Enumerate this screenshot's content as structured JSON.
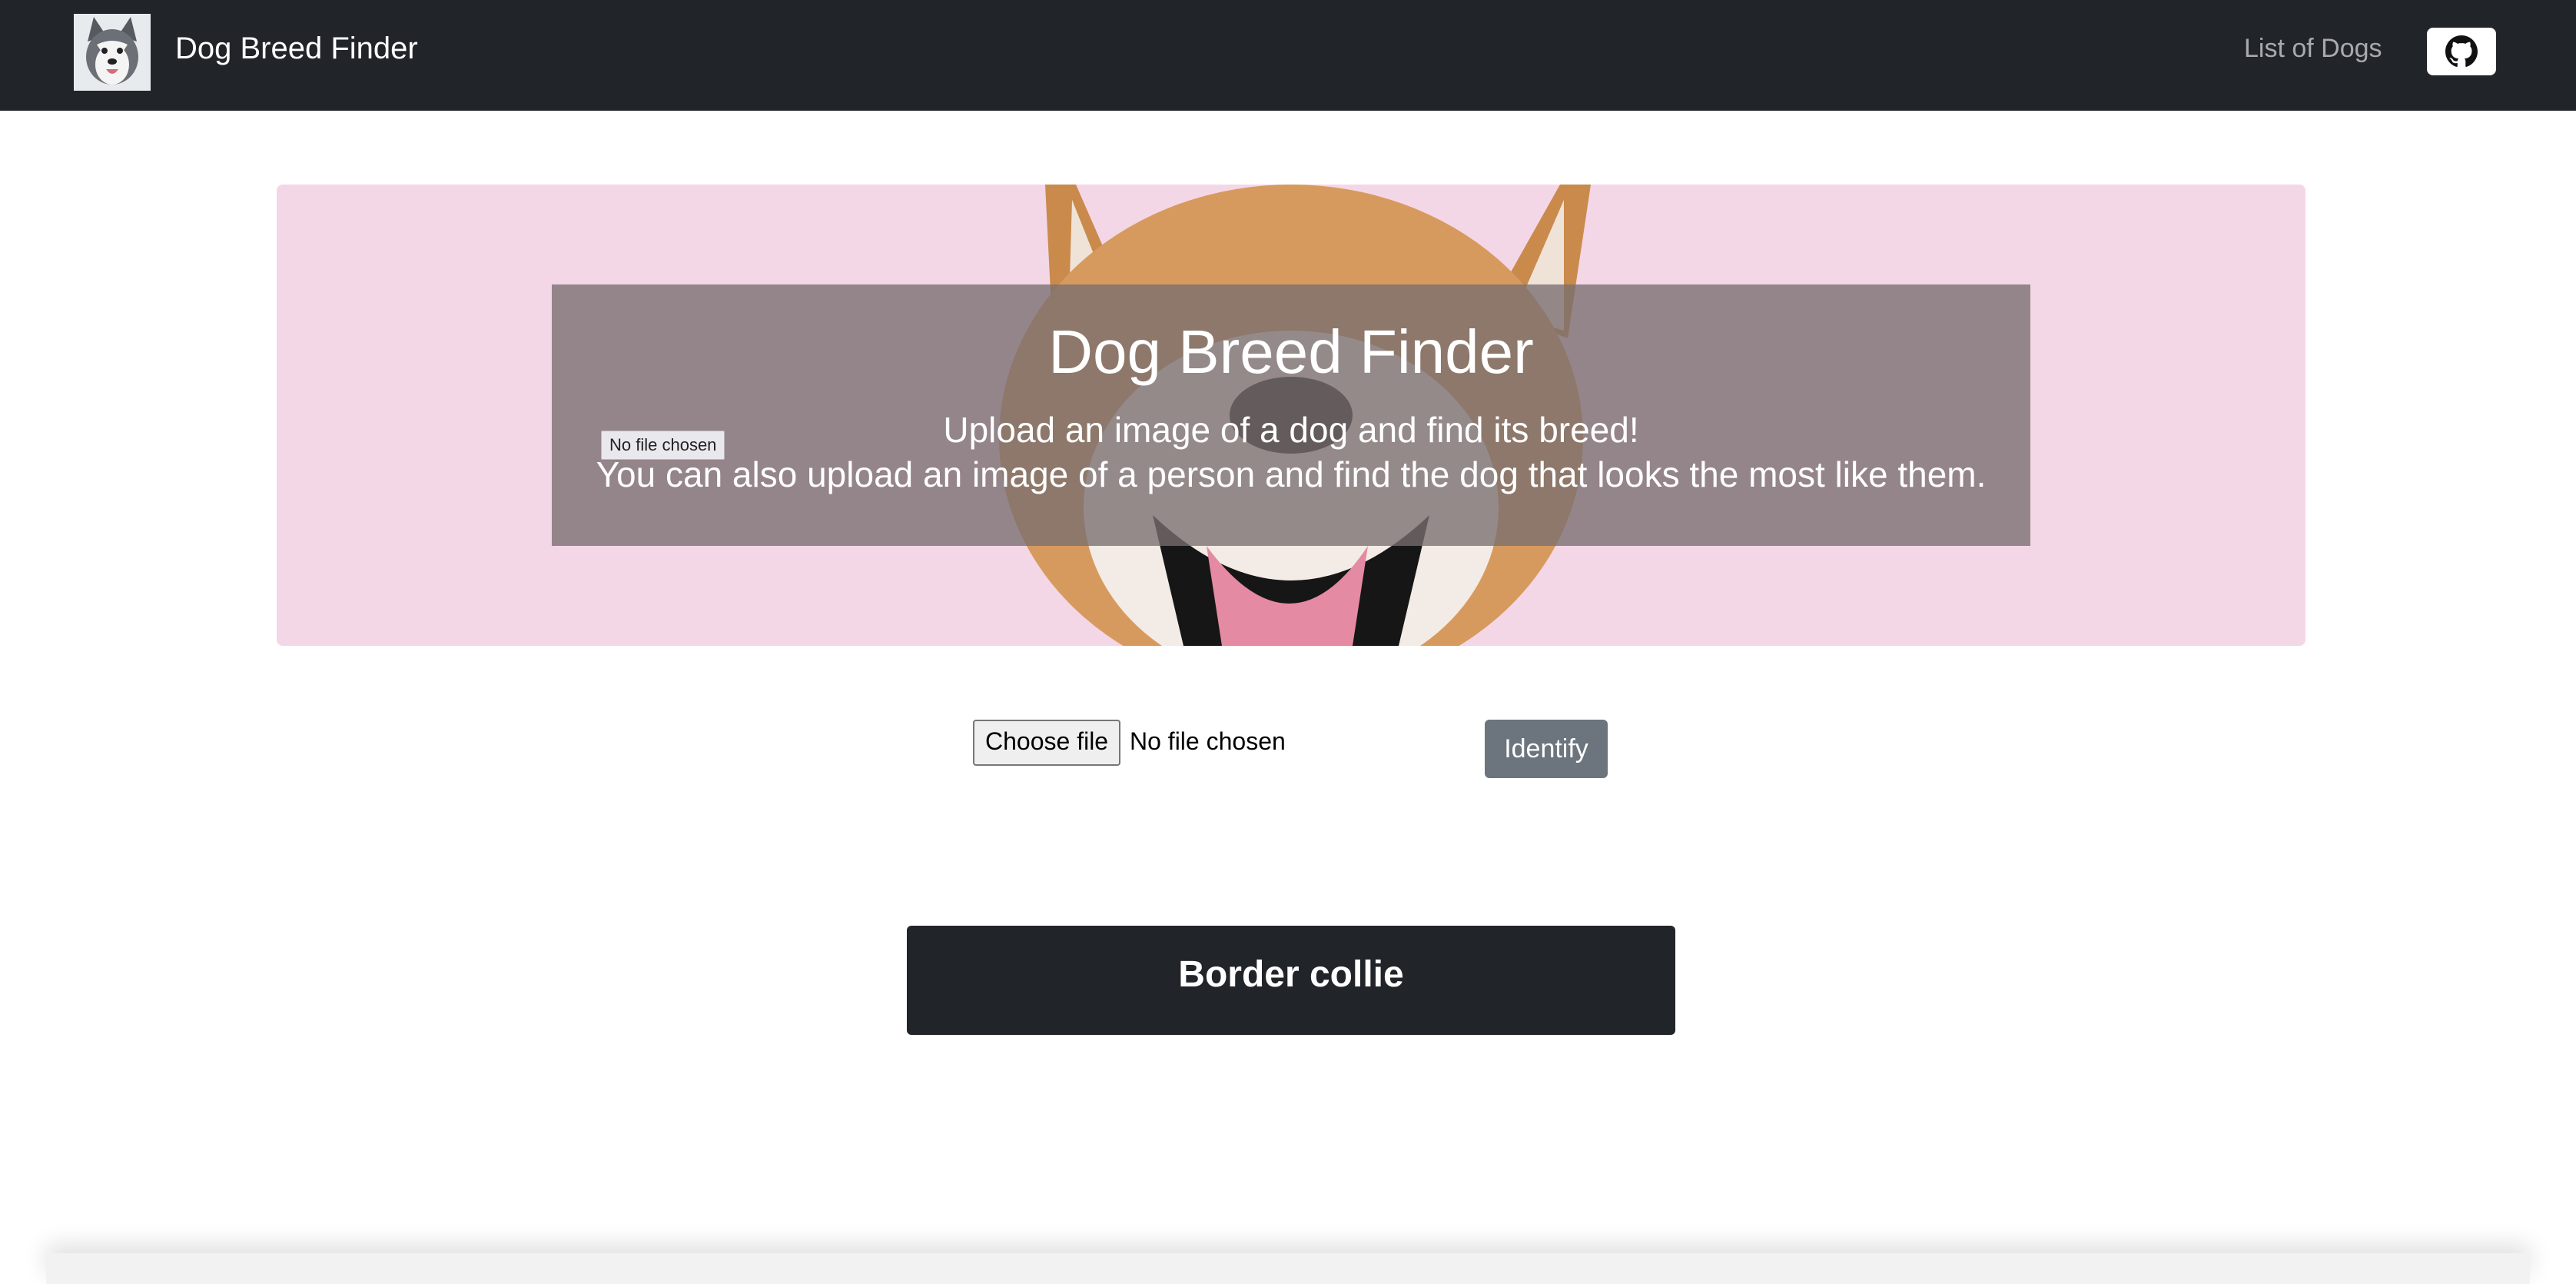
{
  "navbar": {
    "brand_title": "Dog Breed Finder",
    "logo_icon": "husky-dog-logo-icon",
    "nav_link": "List of Dogs",
    "github_icon": "github-icon"
  },
  "hero": {
    "title": "Dog Breed Finder",
    "line1": "Upload an image of a dog and find its breed!",
    "line2": "You can also upload an image of a person and find the dog that looks the most like them.",
    "file_chip": "No file chosen",
    "background_color": "#f4d7e6"
  },
  "upload": {
    "choose_label": "Choose file",
    "file_status": "No file chosen",
    "identify_label": "Identify"
  },
  "result": {
    "breed": "Border collie"
  },
  "colors": {
    "navbar": "#212529",
    "secondary_button": "#6c757d",
    "result_box": "#212529"
  }
}
